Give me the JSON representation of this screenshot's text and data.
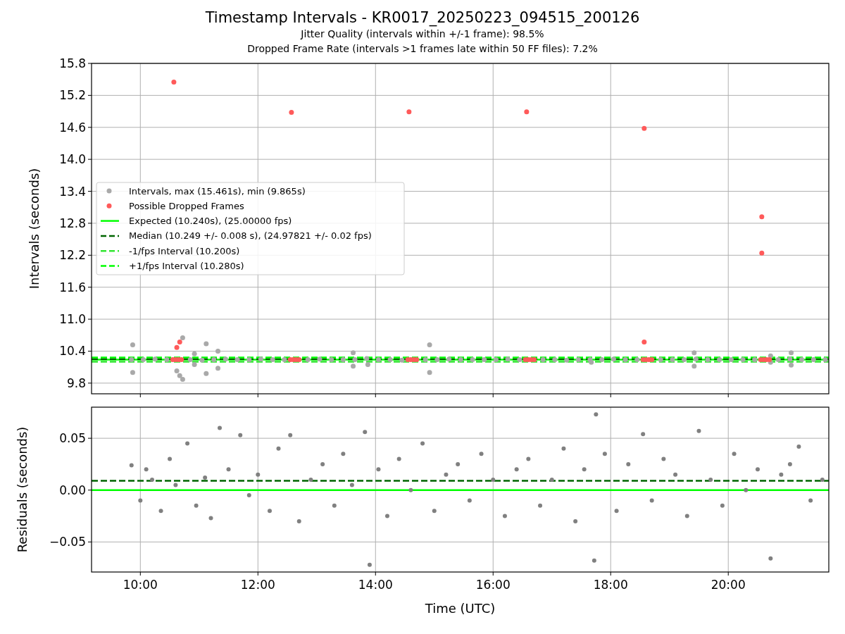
{
  "figure": {
    "title": "Timestamp Intervals - KR0017_20250223_094515_200126",
    "subtitles": [
      "Jitter Quality (intervals within +/-1 frame): 98.5%",
      "Dropped Frame Rate (intervals >1 frames late within 50 FF files): 7.2%"
    ]
  },
  "intervals_panel": {
    "chart_data": {
      "type": "scatter",
      "grid": true,
      "legend": true,
      "ylabel": "Intervals (seconds)",
      "xlim": [
        9.17,
        21.71
      ],
      "ylim": [
        9.6,
        15.8
      ],
      "yticks": [
        {
          "value": 9.8,
          "label": "9.8"
        },
        {
          "value": 10.4,
          "label": "10.4"
        },
        {
          "value": 11.0,
          "label": "11.0"
        },
        {
          "value": 11.6,
          "label": "11.6"
        },
        {
          "value": 12.2,
          "label": "12.2"
        },
        {
          "value": 12.8,
          "label": "12.8"
        },
        {
          "value": 13.4,
          "label": "13.4"
        },
        {
          "value": 14.0,
          "label": "14.0"
        },
        {
          "value": 14.6,
          "label": "14.6"
        },
        {
          "value": 15.2,
          "label": "15.2"
        },
        {
          "value": 15.8,
          "label": "15.8"
        }
      ],
      "series": [
        {
          "name": "Intervals, max (15.461s), min (9.865s)",
          "color": "#a9a9a9",
          "x": [
            9.85,
            10.05,
            10.25,
            10.45,
            10.85,
            11.05,
            11.25,
            11.45,
            11.65,
            11.85,
            12.05,
            12.25,
            12.45,
            12.85,
            13.05,
            13.25,
            13.45,
            13.65,
            13.85,
            14.05,
            14.25,
            14.45,
            14.85,
            15.05,
            15.25,
            15.45,
            15.65,
            15.85,
            16.05,
            16.25,
            16.45,
            16.85,
            17.05,
            17.25,
            17.45,
            17.65,
            17.85,
            18.05,
            18.25,
            18.45,
            18.85,
            19.05,
            19.25,
            19.45,
            19.65,
            19.85,
            20.05,
            20.25,
            20.45,
            20.85,
            21.05,
            21.25,
            21.45,
            21.65,
            9.87,
            9.87,
            10.62,
            10.67,
            10.72,
            10.72,
            10.92,
            10.92,
            11.12,
            11.12,
            11.32,
            11.32,
            13.62,
            13.62,
            13.87,
            14.92,
            14.92,
            17.67,
            19.42,
            19.42,
            20.72,
            20.72,
            21.07,
            21.07
          ],
          "values": [
            10.24,
            10.24,
            10.25,
            10.24,
            10.24,
            10.23,
            10.24,
            10.25,
            10.24,
            10.24,
            10.25,
            10.24,
            10.24,
            10.24,
            10.25,
            10.24,
            10.24,
            10.24,
            10.26,
            10.24,
            10.24,
            10.23,
            10.24,
            10.24,
            10.25,
            10.24,
            10.24,
            10.24,
            10.24,
            10.25,
            10.24,
            10.24,
            10.24,
            10.23,
            10.24,
            10.24,
            10.24,
            10.25,
            10.24,
            10.24,
            10.24,
            10.24,
            10.24,
            10.25,
            10.24,
            10.24,
            10.24,
            10.24,
            10.24,
            10.24,
            10.25,
            10.24,
            10.24,
            10.24,
            10.52,
            10.0,
            10.03,
            9.94,
            9.87,
            10.65,
            10.35,
            10.15,
            10.54,
            9.98,
            10.4,
            10.08,
            10.37,
            10.12,
            10.15,
            10.52,
            10.0,
            10.19,
            10.37,
            10.12,
            10.31,
            10.19,
            10.37,
            10.14
          ]
        },
        {
          "name": "Possible Dropped Frames",
          "color": "#ff5a5a",
          "x": [
            10.55,
            10.6,
            10.65,
            10.7,
            12.55,
            12.6,
            12.65,
            12.7,
            14.55,
            14.6,
            14.65,
            14.7,
            16.55,
            16.6,
            16.65,
            16.7,
            18.55,
            18.6,
            18.65,
            18.7,
            20.55,
            20.6,
            20.65,
            20.7,
            10.57,
            12.57,
            14.57,
            16.57,
            18.57,
            20.57,
            20.57,
            18.57,
            10.62,
            10.67
          ],
          "values": [
            10.24,
            10.24,
            10.24,
            10.24,
            10.24,
            10.24,
            10.24,
            10.24,
            10.24,
            10.24,
            10.24,
            10.24,
            10.24,
            10.24,
            10.24,
            10.24,
            10.24,
            10.24,
            10.24,
            10.24,
            10.24,
            10.24,
            10.24,
            10.24,
            15.45,
            14.88,
            14.89,
            14.89,
            14.58,
            12.92,
            12.24,
            10.57,
            10.47,
            10.57
          ]
        },
        {
          "name": "Expected (10.240s), (25.00000 fps)",
          "type": "line",
          "line_style": "solid",
          "color": "#00ff00",
          "x": [
            9.17,
            21.71
          ],
          "values": [
            10.24,
            10.24
          ]
        },
        {
          "name": "Median (10.249 +/- 0.008 s), (24.97821 +/- 0.02 fps)",
          "type": "line",
          "line_style": "dashed",
          "color": "#006400",
          "x": [
            9.17,
            21.71
          ],
          "values": [
            10.25,
            10.25
          ]
        },
        {
          "name": "-1/fps Interval (10.200s)",
          "type": "line",
          "line_style": "dashed",
          "color": "#32e632",
          "x": [
            9.17,
            21.71
          ],
          "values": [
            10.2,
            10.2
          ]
        },
        {
          "name": "+1/fps Interval (10.280s)",
          "type": "line",
          "line_style": "dashed",
          "color": "#00ff00",
          "x": [
            9.17,
            21.71
          ],
          "values": [
            10.28,
            10.28
          ]
        }
      ]
    }
  },
  "residuals_panel": {
    "chart_data": {
      "grid": true,
      "type": "scatter",
      "ylabel": "Residuals (seconds)",
      "xlabel": "Time (UTC)",
      "xlim": [
        9.17,
        21.71
      ],
      "ylim": [
        -0.079,
        0.08
      ],
      "xticks": [
        {
          "value": 10,
          "label": "10:00"
        },
        {
          "value": 12,
          "label": "12:00"
        },
        {
          "value": 14,
          "label": "14:00"
        },
        {
          "value": 16,
          "label": "16:00"
        },
        {
          "value": 18,
          "label": "18:00"
        },
        {
          "value": 20,
          "label": "20:00"
        }
      ],
      "yticks": [
        {
          "value": -0.05,
          "label": "−0.05"
        },
        {
          "value": 0,
          "label": "0.00"
        },
        {
          "value": 0.05,
          "label": "0.05"
        }
      ],
      "series": [
        {
          "color": "#808080",
          "x": [
            9.85,
            10.0,
            10.1,
            10.2,
            10.35,
            10.5,
            10.6,
            10.8,
            10.95,
            11.1,
            11.2,
            11.35,
            11.5,
            11.7,
            11.85,
            12.0,
            12.2,
            12.35,
            12.55,
            12.7,
            12.9,
            13.1,
            13.3,
            13.45,
            13.6,
            13.82,
            13.9,
            14.05,
            14.2,
            14.4,
            14.6,
            14.8,
            15.0,
            15.2,
            15.4,
            15.6,
            15.8,
            16.0,
            16.2,
            16.4,
            16.6,
            16.8,
            17.0,
            17.2,
            17.4,
            17.55,
            17.72,
            17.75,
            17.9,
            18.1,
            18.3,
            18.55,
            18.7,
            18.9,
            19.1,
            19.3,
            19.5,
            19.7,
            19.9,
            20.1,
            20.3,
            20.5,
            20.72,
            20.9,
            21.05,
            21.2,
            21.4,
            21.6
          ],
          "values": [
            0.024,
            -0.01,
            0.02,
            0.01,
            -0.02,
            0.03,
            0.005,
            0.045,
            -0.015,
            0.012,
            -0.027,
            0.06,
            0.02,
            0.053,
            -0.005,
            0.015,
            -0.02,
            0.04,
            0.053,
            -0.03,
            0.01,
            0.025,
            -0.015,
            0.035,
            0.005,
            0.056,
            -0.072,
            0.02,
            -0.025,
            0.03,
            0.0,
            0.045,
            -0.02,
            0.015,
            0.025,
            -0.01,
            0.035,
            0.01,
            -0.025,
            0.02,
            0.03,
            -0.015,
            0.01,
            0.04,
            -0.03,
            0.02,
            -0.068,
            0.073,
            0.035,
            -0.02,
            0.025,
            0.054,
            -0.01,
            0.03,
            0.015,
            -0.025,
            0.057,
            0.01,
            -0.015,
            0.035,
            0.0,
            0.02,
            -0.066,
            0.015,
            0.025,
            0.042,
            -0.01,
            0.01
          ]
        },
        {
          "type": "line",
          "line_style": "dashed",
          "color": "#006400",
          "x": [
            9.17,
            21.71
          ],
          "values": [
            0.009,
            0.009
          ]
        },
        {
          "type": "line",
          "line_style": "solid",
          "color": "#00ff00",
          "x": [
            9.17,
            21.71
          ],
          "values": [
            0,
            0
          ]
        }
      ]
    }
  }
}
